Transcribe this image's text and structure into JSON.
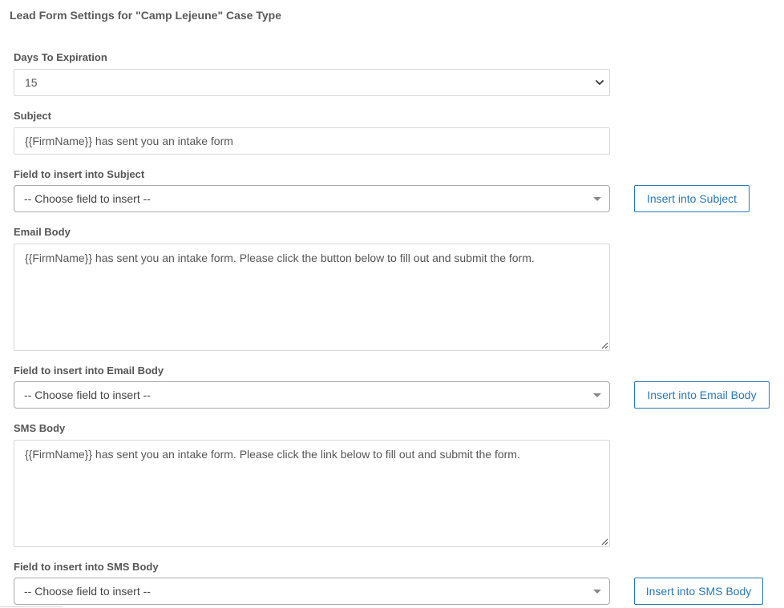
{
  "page": {
    "title": "Lead Form Settings for \"Camp Lejeune\" Case Type"
  },
  "days_to_expiration": {
    "label": "Days To Expiration",
    "value": "15"
  },
  "subject": {
    "label": "Subject",
    "value": "{{FirmName}} has sent you an intake form"
  },
  "subject_field_insert": {
    "label": "Field to insert into Subject",
    "placeholder": "-- Choose field to insert --",
    "button_label": "Insert into Subject"
  },
  "email_body": {
    "label": "Email Body",
    "value": "{{FirmName}} has sent you an intake form. Please click the button below to fill out and submit the form."
  },
  "email_body_field_insert": {
    "label": "Field to insert into Email Body",
    "placeholder": "-- Choose field to insert --",
    "button_label": "Insert into Email Body"
  },
  "sms_body": {
    "label": "SMS Body",
    "value": "{{FirmName}} has sent you an intake form. Please click the link below to fill out and submit the form."
  },
  "sms_body_field_insert": {
    "label": "Field to insert into SMS Body",
    "placeholder": "-- Choose field to insert --",
    "button_label": "Insert into SMS Body"
  },
  "icons": {
    "select_arrow": "chevron-down-icon",
    "dropdown_caret": "caret-down-icon",
    "resize_handle": "resize-handle-icon"
  },
  "colors": {
    "accent": "#2a78b5",
    "label_text": "#555555",
    "border": "#d8d8d8"
  }
}
